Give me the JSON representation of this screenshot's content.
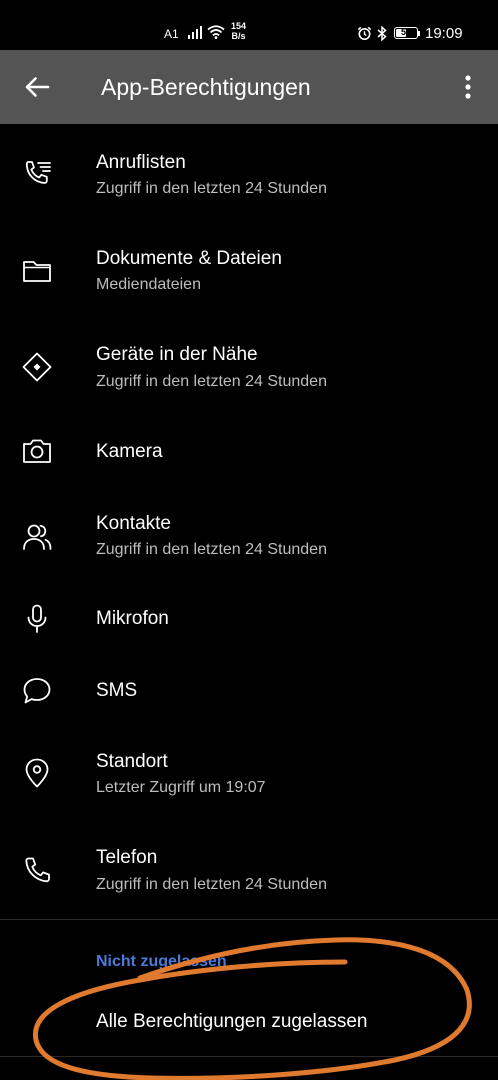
{
  "status_bar": {
    "carrier": "A1",
    "net_speed_value": "154",
    "net_speed_unit": "B/s",
    "battery_level": "53",
    "time": "19:09"
  },
  "app_bar": {
    "title": "App-Berechtigungen",
    "back_icon": "arrow-back-icon",
    "menu_icon": "more-vert-icon"
  },
  "permissions": [
    {
      "icon": "call-log-icon",
      "title": "Anruflisten",
      "subtitle": "Zugriff in den letzten 24 Stunden"
    },
    {
      "icon": "folder-icon",
      "title": "Dokumente & Dateien",
      "subtitle": "Mediendateien"
    },
    {
      "icon": "nearby-devices-icon",
      "title": "Geräte in der Nähe",
      "subtitle": "Zugriff in den letzten 24 Stunden"
    },
    {
      "icon": "camera-icon",
      "title": "Kamera",
      "subtitle": ""
    },
    {
      "icon": "contacts-icon",
      "title": "Kontakte",
      "subtitle": "Zugriff in den letzten 24 Stunden"
    },
    {
      "icon": "microphone-icon",
      "title": "Mikrofon",
      "subtitle": ""
    },
    {
      "icon": "sms-icon",
      "title": "SMS",
      "subtitle": ""
    },
    {
      "icon": "location-icon",
      "title": "Standort",
      "subtitle": "Letzter Zugriff um 19:07"
    },
    {
      "icon": "phone-icon",
      "title": "Telefon",
      "subtitle": "Zugriff in den letzten 24 Stunden"
    }
  ],
  "not_allowed_section": {
    "header": "Nicht zugelassen",
    "empty_label": "Alle Berechtigungen zugelassen"
  },
  "colors": {
    "background": "#000000",
    "app_bar": "#545454",
    "section_header": "#4a7bd8",
    "annotation": "#e07a2e",
    "subtitle": "#bdbdbd"
  }
}
